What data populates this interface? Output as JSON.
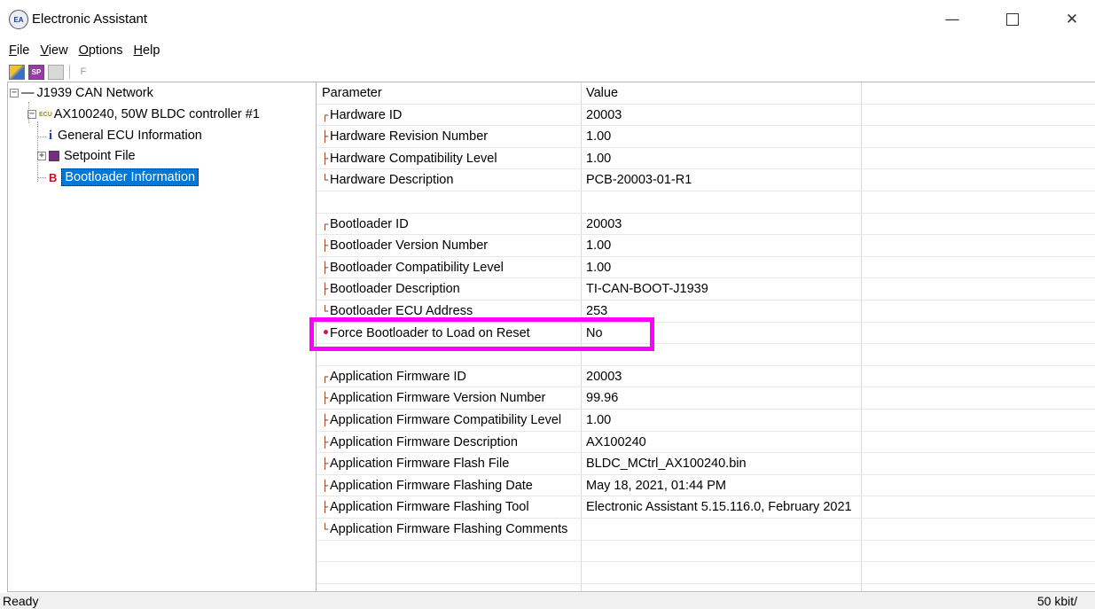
{
  "window": {
    "title": "Electronic Assistant",
    "icon_name": "electronic-assistant-logo-icon",
    "icon_text": "EA",
    "minimize_glyph": "—",
    "close_glyph": "✕"
  },
  "menu": {
    "items": [
      {
        "mnemonic": "F",
        "rest": "ile"
      },
      {
        "mnemonic": "V",
        "rest": "iew"
      },
      {
        "mnemonic": "O",
        "rest": "ptions"
      },
      {
        "mnemonic": "H",
        "rest": "elp"
      }
    ]
  },
  "toolbar": {
    "f_label": "F"
  },
  "tree": {
    "root": {
      "label": "J1939 CAN Network",
      "expander": "⊟"
    },
    "ecu": {
      "label": "AX100240, 50W BLDC controller #1",
      "expander": "⊟",
      "icon_text": "ECU"
    },
    "children": [
      {
        "label": "General ECU Information",
        "icon_glyph": "i"
      },
      {
        "label": "Setpoint File",
        "expander": "⊞"
      },
      {
        "label": "Bootloader Information",
        "icon_glyph": "B",
        "selected": true
      }
    ]
  },
  "grid": {
    "headers": {
      "parameter": "Parameter",
      "value": "Value"
    },
    "rows": [
      {
        "marker": "┌",
        "parameter": "Hardware ID",
        "value": "20003"
      },
      {
        "marker": "├",
        "parameter": "Hardware Revision Number",
        "value": "1.00"
      },
      {
        "marker": "├",
        "parameter": "Hardware Compatibility Level",
        "value": "1.00"
      },
      {
        "marker": "└",
        "parameter": "Hardware Description",
        "value": "PCB-20003-01-R1"
      },
      {
        "marker": "",
        "parameter": "",
        "value": ""
      },
      {
        "marker": "┌",
        "parameter": "Bootloader ID",
        "value": "20003"
      },
      {
        "marker": "├",
        "parameter": "Bootloader Version Number",
        "value": "1.00"
      },
      {
        "marker": "├",
        "parameter": "Bootloader Compatibility Level",
        "value": "1.00"
      },
      {
        "marker": "├",
        "parameter": "Bootloader Description",
        "value": "TI-CAN-BOOT-J1939"
      },
      {
        "marker": "└",
        "parameter": "Bootloader ECU Address",
        "value": "253"
      },
      {
        "marker": "•",
        "parameter": "Force Bootloader to Load on Reset",
        "value": "No",
        "dot": true
      },
      {
        "marker": "",
        "parameter": "",
        "value": ""
      },
      {
        "marker": "┌",
        "parameter": "Application Firmware ID",
        "value": "20003"
      },
      {
        "marker": "├",
        "parameter": "Application Firmware Version Number",
        "value": "99.96"
      },
      {
        "marker": "├",
        "parameter": "Application Firmware Compatibility Level",
        "value": "1.00"
      },
      {
        "marker": "├",
        "parameter": "Application Firmware Description",
        "value": "AX100240"
      },
      {
        "marker": "├",
        "parameter": "Application Firmware Flash File",
        "value": "BLDC_MCtrl_AX100240.bin"
      },
      {
        "marker": "├",
        "parameter": "Application Firmware Flashing Date",
        "value": "May 18, 2021, 01:44 PM"
      },
      {
        "marker": "├",
        "parameter": "Application Firmware Flashing Tool",
        "value": "Electronic Assistant 5.15.116.0, February 2021"
      },
      {
        "marker": "└",
        "parameter": "Application Firmware Flashing Comments",
        "value": ""
      },
      {
        "marker": "",
        "parameter": "",
        "value": ""
      },
      {
        "marker": "",
        "parameter": "",
        "value": ""
      },
      {
        "marker": "",
        "parameter": "",
        "value": ""
      }
    ]
  },
  "status": {
    "left": "Ready",
    "right": "50 kbit/"
  },
  "colors": {
    "highlight": "#ff00ff",
    "selection": "#0078d7",
    "marker": "#8b3a1a",
    "changed_dot": "#e0103a"
  }
}
